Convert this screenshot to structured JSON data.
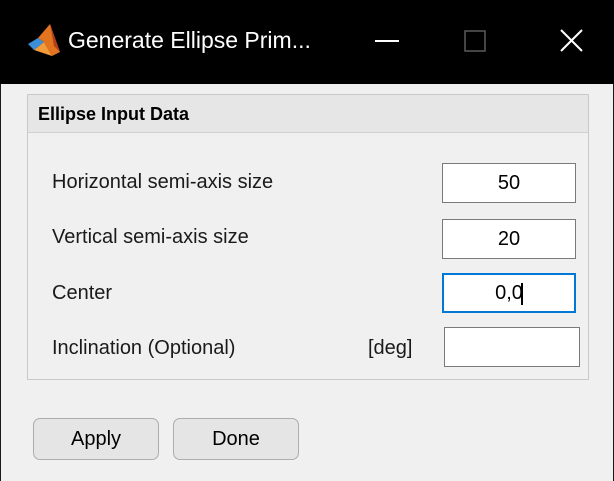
{
  "window": {
    "title": "Generate Ellipse Prim..."
  },
  "panel": {
    "title": "Ellipse Input Data"
  },
  "fields": {
    "horizontal": {
      "label": "Horizontal semi-axis size",
      "value": "50"
    },
    "vertical": {
      "label": "Vertical semi-axis size",
      "value": "20"
    },
    "center": {
      "label": "Center",
      "value": "0,0"
    },
    "inclination": {
      "label": "Inclination (Optional)",
      "unit": "[deg]",
      "value": ""
    }
  },
  "buttons": {
    "apply": "Apply",
    "done": "Done"
  },
  "icons": {
    "app": "matlab-icon",
    "minimize": "minimize-icon",
    "maximize": "maximize-icon",
    "close": "close-icon"
  },
  "colors": {
    "titlebar": "#000000",
    "focus_border": "#0078d7",
    "background": "#f0f0f0"
  }
}
